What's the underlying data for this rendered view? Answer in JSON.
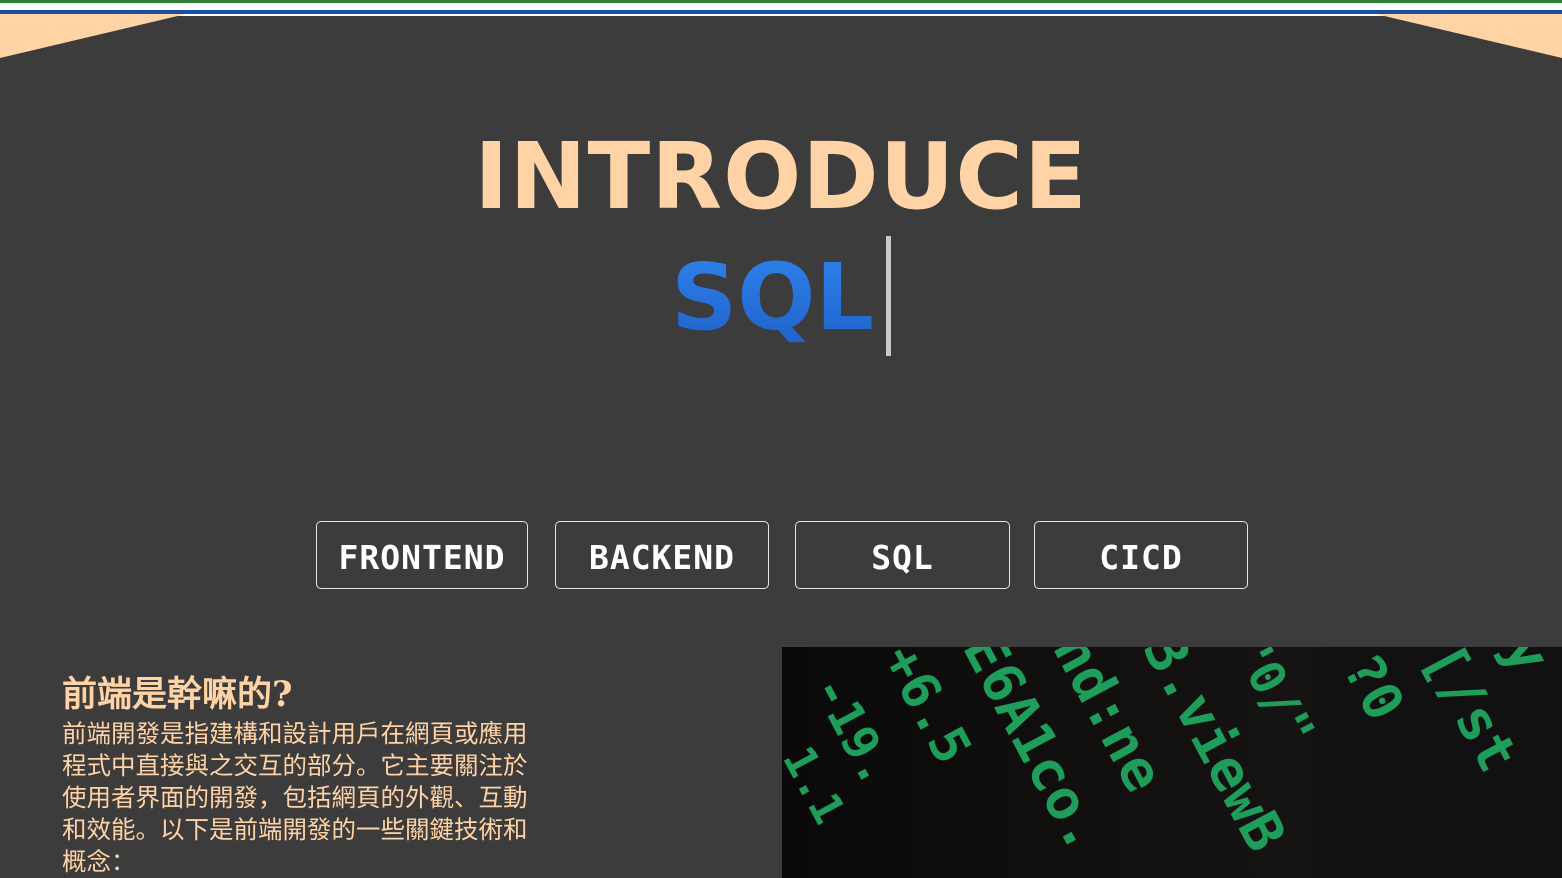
{
  "hero": {
    "title": "INTRODUCE",
    "typed_text": "SQL"
  },
  "nav": {
    "buttons": [
      {
        "label": "FRONTEND"
      },
      {
        "label": "BACKEND"
      },
      {
        "label": "SQL"
      },
      {
        "label": "CICD"
      }
    ]
  },
  "section": {
    "heading": "前端是幹嘛的?",
    "body": "前端開發是指建構和設計用戶在網頁或應用程式中直接與之交互的部分。它主要關注於使用者界面的開發，包括網頁的外觀、互動和效能。以下是前端開發的一些關鍵技術和概念："
  },
  "colors": {
    "background": "#3c3c3c",
    "accent_peach": "#ffd3a5",
    "accent_blue": "#2f86ee",
    "code_green": "#1f9d5a"
  }
}
